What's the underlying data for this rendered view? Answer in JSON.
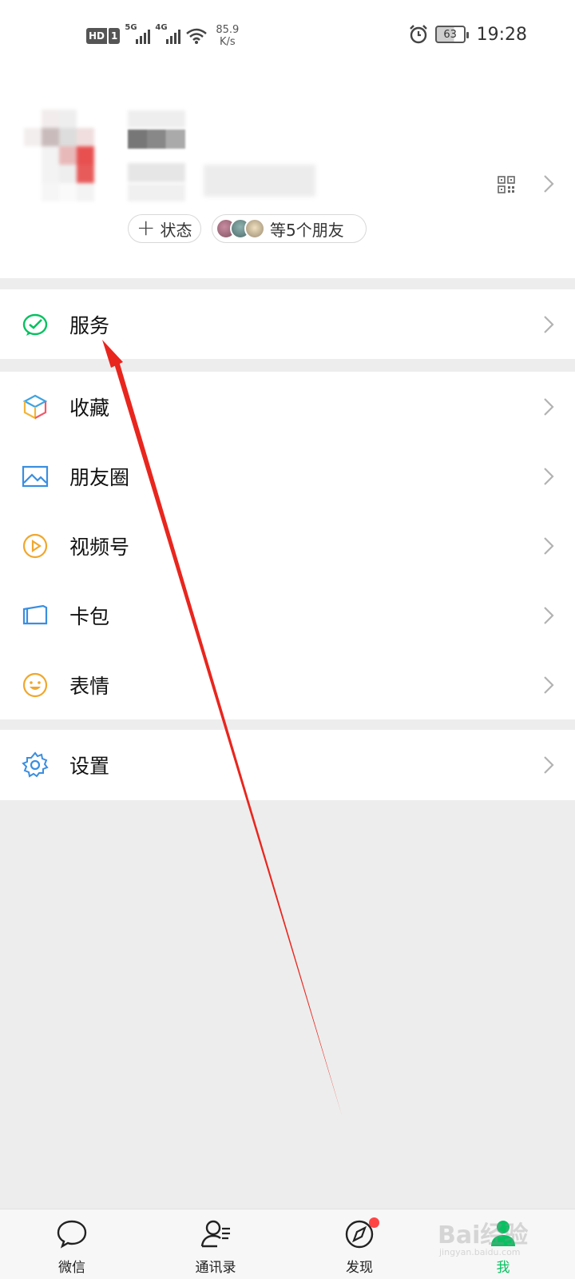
{
  "status_bar": {
    "hd_badge": "HD",
    "sim_slot": "1",
    "network_5g": "5G",
    "network_4g": "4G",
    "speed_value": "85.9",
    "speed_unit": "K/s",
    "battery_level": "63",
    "time": "19:28"
  },
  "profile": {
    "status_button_label": "状态",
    "friends_pill_label": "等5个朋友"
  },
  "menu": {
    "services": {
      "label": "服务",
      "icon": "services-icon"
    },
    "items": [
      {
        "label": "收藏",
        "icon": "favorites-cube-icon"
      },
      {
        "label": "朋友圈",
        "icon": "moments-picture-icon"
      },
      {
        "label": "视频号",
        "icon": "channels-play-icon"
      },
      {
        "label": "卡包",
        "icon": "card-wallet-icon"
      },
      {
        "label": "表情",
        "icon": "sticker-smile-icon"
      }
    ],
    "settings": {
      "label": "设置",
      "icon": "gear-icon"
    }
  },
  "tabbar": {
    "tabs": [
      {
        "label": "微信",
        "icon": "chat-bubble-icon"
      },
      {
        "label": "通讯录",
        "icon": "contacts-icon"
      },
      {
        "label": "发现",
        "icon": "compass-icon"
      },
      {
        "label": "我",
        "icon": "me-person-icon"
      }
    ],
    "active_tab": "我"
  },
  "watermark": {
    "brand": "Bai经验",
    "url": "jingyan.baidu.com"
  },
  "colors": {
    "accent_green": "#07c160",
    "annotation_red": "#e8261e",
    "badge_red": "#ff4444",
    "background": "#ededed"
  }
}
